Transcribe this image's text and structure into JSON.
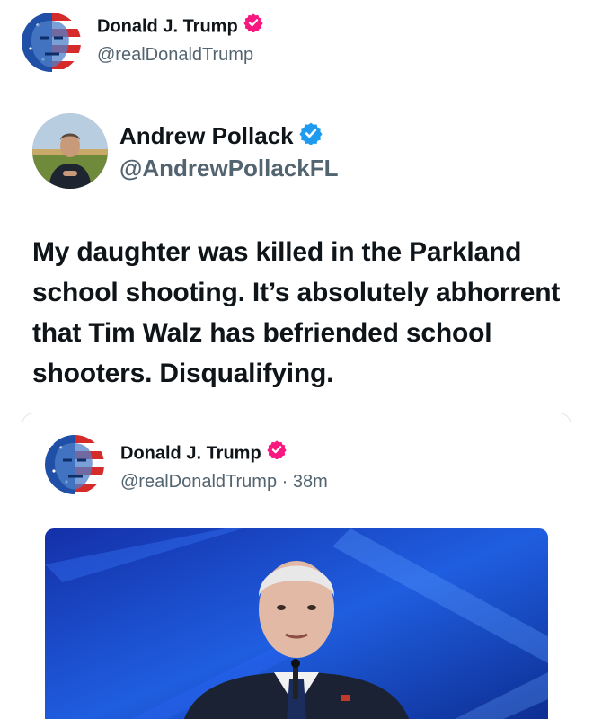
{
  "header": {
    "name": "Donald J. Trump",
    "handle": "@realDonaldTrump"
  },
  "quoted_post": {
    "author": "Andrew Pollack",
    "handle": "@AndrewPollackFL",
    "text": "My daughter was killed in the Parkland school shooting. It’s absolutely abhorrent that Tim Walz has befriended school shooters. Disqualifying."
  },
  "embedded_post": {
    "name": "Donald J. Trump",
    "handle_time": "@realDonaldTrump · 38m"
  },
  "colors": {
    "gold_badge": "#f91880",
    "blue_badge": "#1d9bf0",
    "handle_gray": "#536471"
  },
  "icons": {
    "verified_pink": "verified-badge-icon",
    "verified_blue": "verified-badge-icon"
  }
}
